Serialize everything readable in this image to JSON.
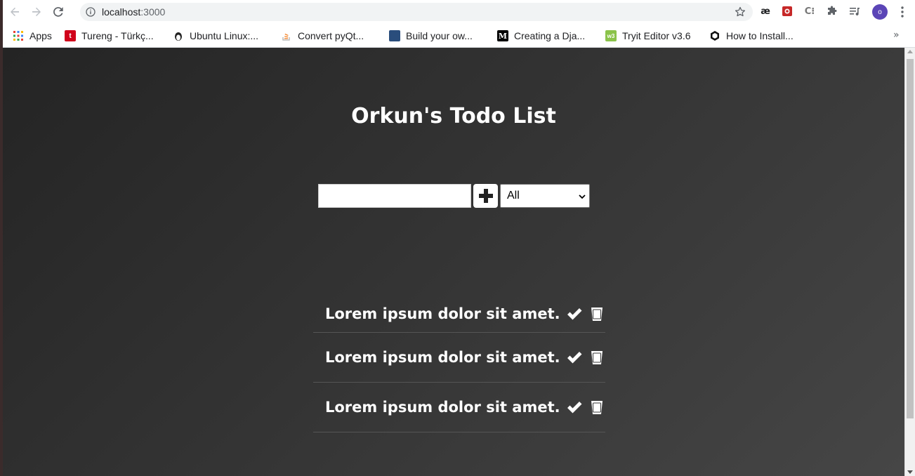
{
  "browser": {
    "url_host": "localhost",
    "url_port": ":3000",
    "profile_initial": "o",
    "bookmarks": [
      {
        "label": "Apps",
        "icon": "apps-grid-icon"
      },
      {
        "label": "Tureng - Türkç...",
        "icon": "tureng-icon",
        "color": "#d0021b"
      },
      {
        "label": "Ubuntu Linux:...",
        "icon": "linux-penguin-icon",
        "color": "#222222"
      },
      {
        "label": "Convert pyQt...",
        "icon": "stackoverflow-icon",
        "color": "#f48024"
      },
      {
        "label": "Build your ow...",
        "icon": "site-icon",
        "color": "#2a4d7c"
      },
      {
        "label": "Creating a Dja...",
        "icon": "medium-icon",
        "color": "#000000"
      },
      {
        "label": "Tryit Editor v3.6",
        "icon": "w3schools-icon",
        "color": "#8bc34a"
      },
      {
        "label": "How to Install...",
        "icon": "hexagon-icon",
        "color": "#111111"
      }
    ],
    "more_bookmarks": "»"
  },
  "app": {
    "title": "Orkun's Todo List",
    "input_value": "",
    "filter_selected": "All",
    "todos": [
      {
        "text": "Lorem ipsum dolor sit amet."
      },
      {
        "text": "Lorem ipsum dolor sit amet."
      },
      {
        "text": "Lorem ipsum dolor sit amet."
      }
    ]
  },
  "colors": {
    "page_text": "#ffffff",
    "profile_bg": "#5b45b7"
  }
}
